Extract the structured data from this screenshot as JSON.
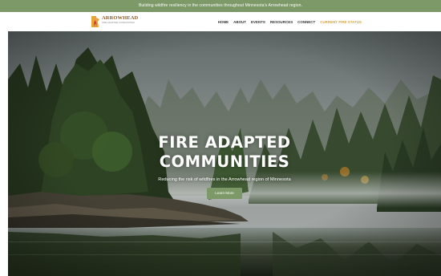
{
  "announcement": {
    "text": "Building wildfire resiliency in the communities throughout Minnesota's Arrowhead region."
  },
  "logo": {
    "title": "ARROWHEAD",
    "subtitle": "FIRE ADAPTED COMMUNITIES",
    "icon": "minnesota-flame-icon"
  },
  "nav": {
    "items": [
      {
        "label": "HOME"
      },
      {
        "label": "ABOUT"
      },
      {
        "label": "EVENTS"
      },
      {
        "label": "RESOURCES"
      },
      {
        "label": "CONNECT"
      },
      {
        "label": "CURRENT FIRE STATUS"
      }
    ]
  },
  "hero": {
    "title_line1": "FIRE ADAPTED",
    "title_line2": "COMMUNITIES",
    "subtitle": "Reducing the risk of wildfires in the Arrowhead region of Minnesota",
    "button_label": "Learn More"
  },
  "colors": {
    "brand_green": "#7d9968",
    "accent_gold": "#d9a53c",
    "logo_brown": "#8a5a2b"
  }
}
